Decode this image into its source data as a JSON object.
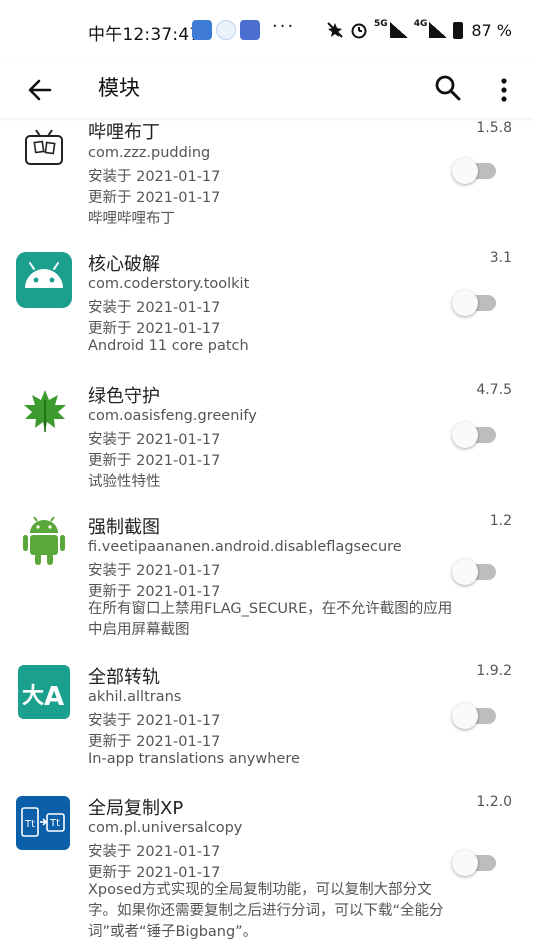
{
  "status_bar": {
    "time": "中午12:37:47",
    "dots": "···",
    "signal1_label": "5G",
    "signal2_label": "4G",
    "battery": "87 %"
  },
  "app_bar": {
    "title": "模块"
  },
  "modules": [
    {
      "title": "哔哩布丁",
      "package": "com.zzz.pudding",
      "installed": "安装于 2021-01-17",
      "updated": "更新于 2021-01-17",
      "description": "哔哩哔哩布丁",
      "version": "1.5.8",
      "enabled": false,
      "icon": "tv-icon"
    },
    {
      "title": "核心破解",
      "package": "com.coderstory.toolkit",
      "installed": "安装于 2021-01-17",
      "updated": "更新于 2021-01-17",
      "description": "Android 11 core patch",
      "version": "3.1",
      "enabled": false,
      "icon": "android-icon"
    },
    {
      "title": "绿色守护",
      "package": "com.oasisfeng.greenify",
      "installed": "安装于 2021-01-17",
      "updated": "更新于 2021-01-17",
      "description": "试验性特性",
      "version": "4.7.5",
      "enabled": false,
      "icon": "leaf-icon"
    },
    {
      "title": "强制截图",
      "package": "fi.veetipaananen.android.disableflagsecure",
      "installed": "安装于 2021-01-17",
      "updated": "更新于 2021-01-17",
      "description": "在所有窗口上禁用FLAG_SECURE，在不允许截图的应用中启用屏幕截图",
      "version": "1.2",
      "enabled": false,
      "icon": "android-robot-icon"
    },
    {
      "title": "全部转轨",
      "package": "akhil.alltrans",
      "installed": "安装于 2021-01-17",
      "updated": "更新于 2021-01-17",
      "description": "In-app translations anywhere",
      "version": "1.9.2",
      "enabled": false,
      "icon": "translate-icon"
    },
    {
      "title": "全局复制XP",
      "package": "com.pl.universalcopy",
      "installed": "安装于 2021-01-17",
      "updated": "更新于 2021-01-17",
      "description": "Xposed方式实现的全局复制功能，可以复制大部分文字。如果你还需要复制之后进行分词，可以下载“全能分词”或者“锤子Bigbang”。",
      "version": "1.2.0",
      "enabled": false,
      "icon": "copy-icon"
    }
  ],
  "colors": {
    "teal": "#1aa08c",
    "green_android": "#5aa83a",
    "copy_blue": "#0b5fa8",
    "toggle_track": "#bdbdbd"
  }
}
